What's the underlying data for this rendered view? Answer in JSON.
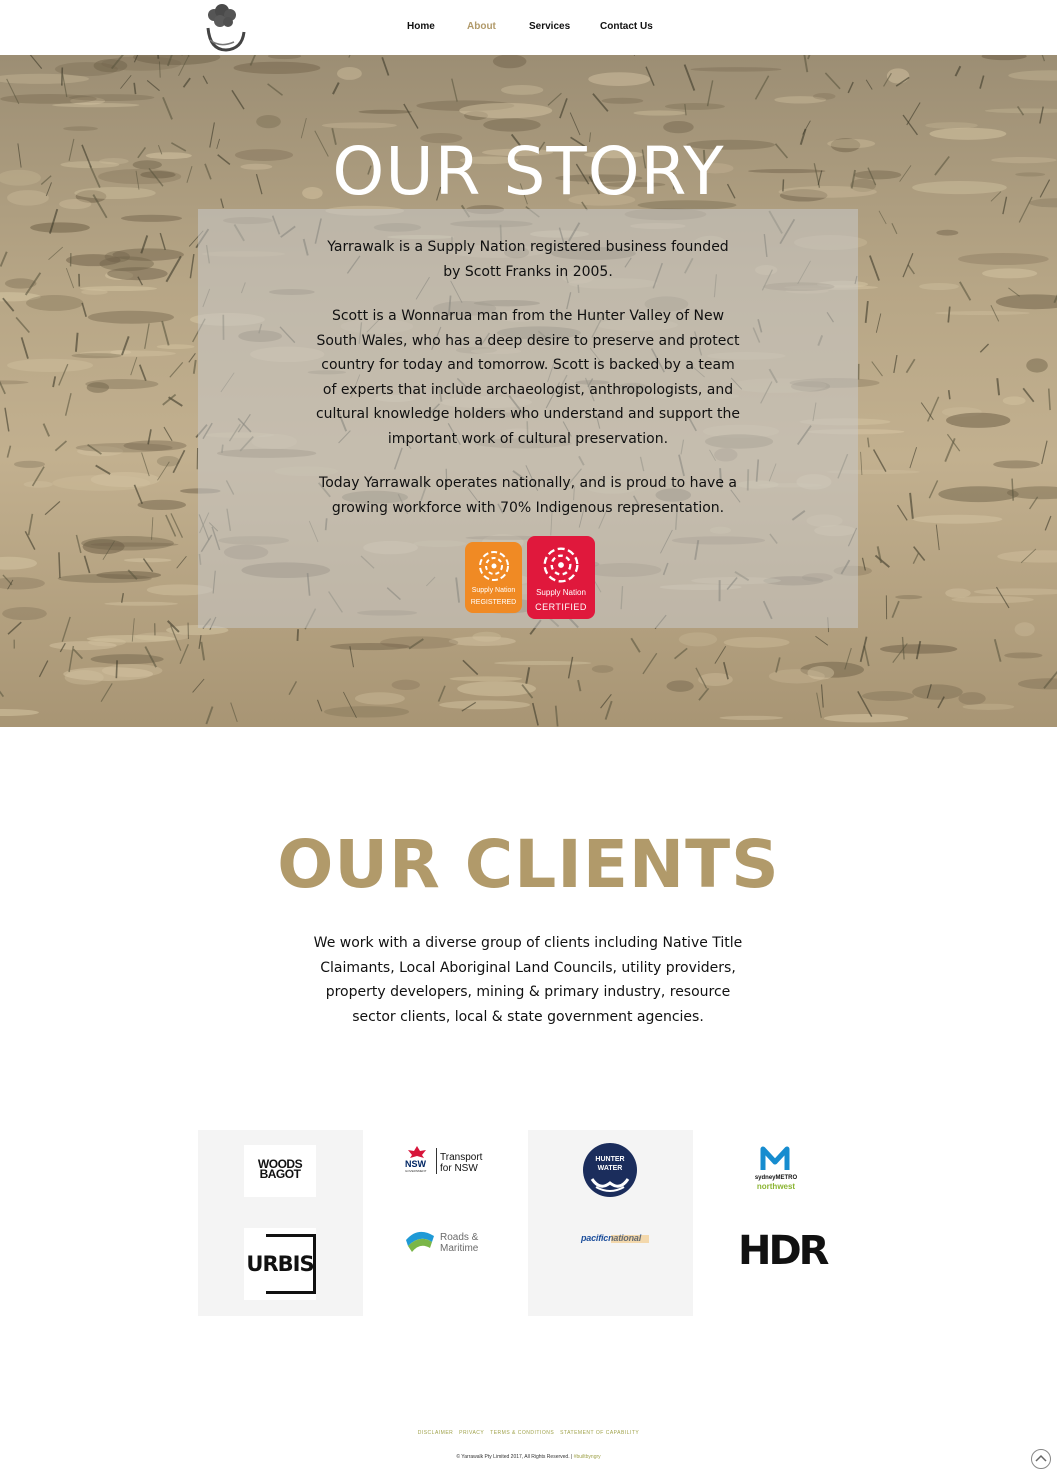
{
  "nav": {
    "items": [
      {
        "label": "Home",
        "active": false
      },
      {
        "label": "About",
        "active": true
      },
      {
        "label": "Services",
        "active": false
      },
      {
        "label": "Contact Us",
        "active": false
      }
    ],
    "accent_color": "#b19a6a"
  },
  "hero": {
    "title": "OUR STORY",
    "paragraphs": [
      "Yarrawalk is a Supply Nation registered business founded by Scott Franks in 2005.",
      "Scott is a Wonnarua man from the Hunter Valley of New South Wales, who has a deep desire to preserve and protect country for today and tomorrow. Scott is backed by a team of experts that include archaeologist, anthropologists, and cultural knowledge holders who understand and support the important work of cultural preservation.",
      "Today Yarrawalk operates nationally, and is proud to have a growing workforce with 70% Indigenous representation."
    ],
    "badges": [
      {
        "line1": "Supply Nation",
        "line2": "REGISTERED",
        "color": "#f08a24"
      },
      {
        "line1": "Supply Nation",
        "line2": "CERTIFIED",
        "color": "#e0183c"
      }
    ]
  },
  "clients": {
    "title": "OUR CLIENTS",
    "text": "We work with a diverse group of clients including Native Title Claimants, Local Aboriginal Land Councils, utility providers, property developers, mining & primary industry, resource sector clients, local & state government agencies.",
    "logos": {
      "woods_bagot": [
        "WOODS",
        "BAGOT"
      ],
      "transport": {
        "nsw": "NSW",
        "gov": "GOVERNMENT",
        "line1": "Transport",
        "line2": "for NSW"
      },
      "hunter_water": [
        "HUNTER",
        "WATER"
      ],
      "sydney_metro": {
        "line1": "sydneyMETRO",
        "line2": "northwest"
      },
      "urbis": "URBIS",
      "roads_maritime": [
        "Roads &",
        "Maritime"
      ],
      "pacific_national": "pacificnational",
      "hdr": "HDR"
    }
  },
  "footer": {
    "links": [
      "DISCLAIMER",
      "PRIVACY",
      "TERMS & CONDITIONS",
      "STATEMENT OF CAPABILITY"
    ],
    "copyright": "© Yarrawalk Pty Limited 2017, All Rights Reserved.",
    "credit": "#builtbyngry"
  }
}
